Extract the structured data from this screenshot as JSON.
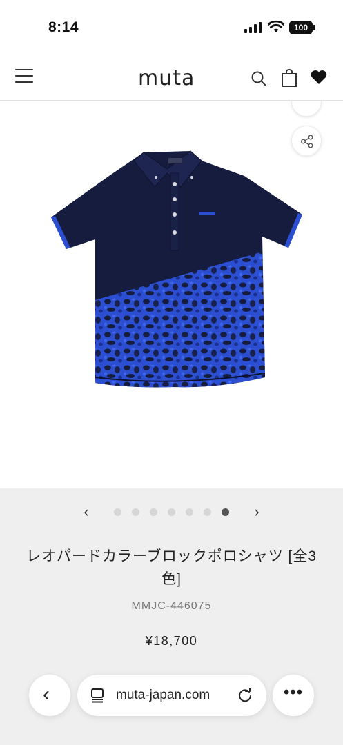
{
  "status_bar": {
    "time": "8:14",
    "battery": "100"
  },
  "header": {
    "logo": "muta"
  },
  "carousel": {
    "prev": "‹",
    "next": "›",
    "dot_count": 7,
    "active_index": 6
  },
  "product": {
    "title": "レオパードカラーブロックポロシャツ [全3色]",
    "sku": "MMJC-446075",
    "price": "¥18,700"
  },
  "browser": {
    "url": "muta-japan.com",
    "back": "‹",
    "more": "•••"
  },
  "colors": {
    "navy": "#161c3e",
    "royal_blue": "#2b4fd0",
    "background": "#efefef"
  }
}
